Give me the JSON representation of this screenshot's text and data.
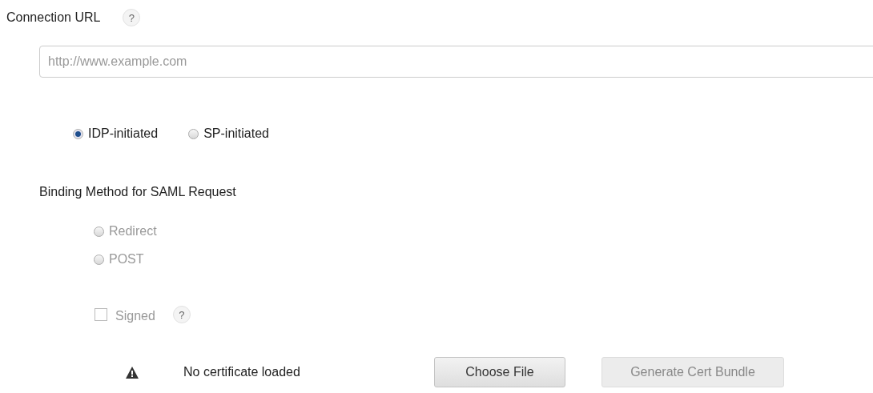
{
  "connection_url": {
    "label": "Connection URL",
    "help": "?",
    "placeholder": "http://www.example.com"
  },
  "initiation": [
    {
      "label": "IDP-initiated",
      "selected": true
    },
    {
      "label": "SP-initiated",
      "selected": false
    }
  ],
  "binding": {
    "label": "Binding Method for SAML Request",
    "options": [
      {
        "label": "Redirect",
        "selected": false,
        "disabled": true
      },
      {
        "label": "POST",
        "selected": false,
        "disabled": true
      }
    ]
  },
  "signed": {
    "label": "Signed",
    "help": "?",
    "checked": false,
    "disabled": true
  },
  "certificate": {
    "status": "No certificate loaded"
  },
  "buttons": [
    {
      "label": "Choose File",
      "disabled": false
    },
    {
      "label": "Generate Cert Bundle",
      "disabled": true
    }
  ]
}
